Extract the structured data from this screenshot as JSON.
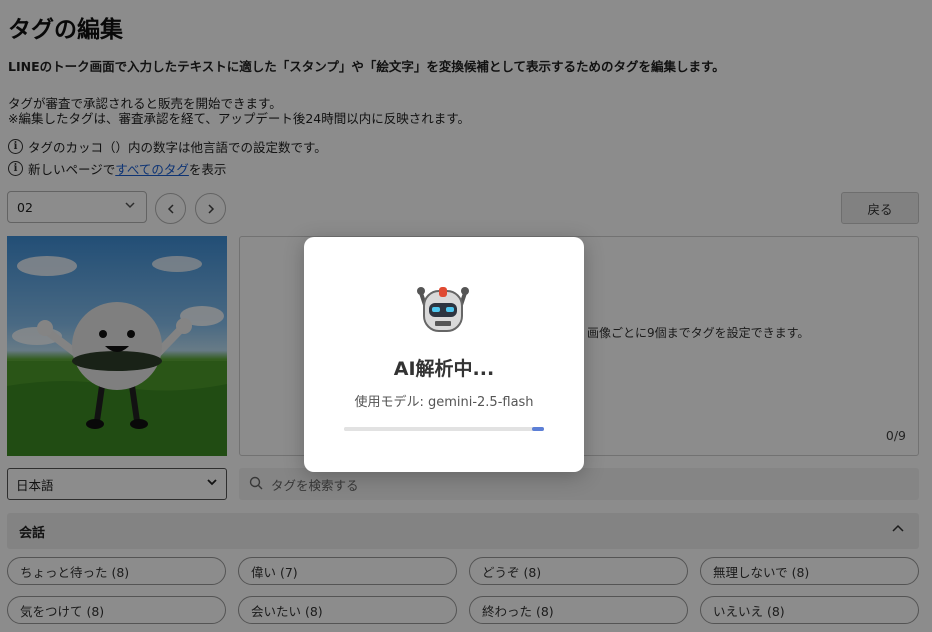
{
  "page": {
    "title": "タグの編集",
    "description": "LINEのトーク画面で入力したテキストに適した「スタンプ」や「絵文字」を変換候補として表示するためのタグを編集します。",
    "note_line1": "タグが審査で承認されると販売を開始できます。",
    "note_line2": "※編集したタグは、審査承認を経て、アップデート後24時間以内に反映されます。",
    "info1": "タグのカッコ（）内の数字は他言語での設定数です。",
    "info2_prefix": "新しいページで",
    "info2_link": "すべてのタグ",
    "info2_suffix": "を表示"
  },
  "controls": {
    "sticker_number": "02",
    "back_label": "戻る",
    "language": "日本語",
    "search_placeholder": "タグを検索する"
  },
  "tag_box": {
    "hint": "画像ごとに9個までタグを設定できます。",
    "count": "0/9"
  },
  "category": {
    "title": "会話",
    "chips": [
      "ちょっと待った (8)",
      "偉い (7)",
      "どうぞ (8)",
      "無理しないで (8)",
      "気をつけて (8)",
      "会いたい (8)",
      "終わった (8)",
      "いえいえ (8)"
    ]
  },
  "modal": {
    "title": "AI解析中...",
    "model_label": "使用モデル: gemini-2.5-flash",
    "progress": 1.0,
    "accent_color": "#5c7fd6"
  },
  "icons": {
    "info": "info-icon",
    "prev": "chevron-left-icon",
    "next": "chevron-right-icon",
    "dropdown": "chevron-down-icon",
    "search": "search-icon",
    "collapse": "chevron-up-icon",
    "robot": "robot-icon"
  }
}
